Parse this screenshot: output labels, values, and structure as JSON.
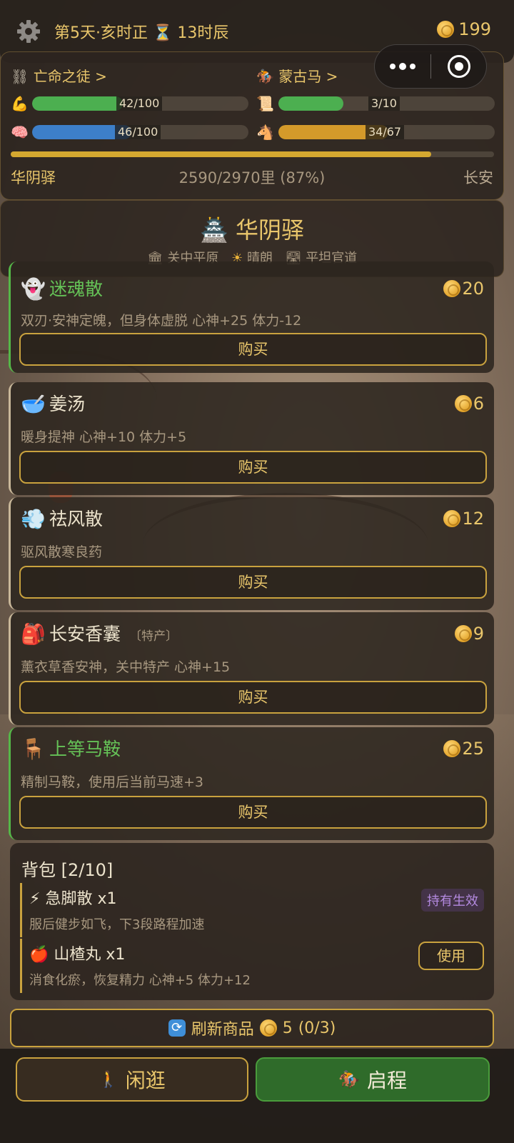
{
  "header": {
    "day_time": "第5天·亥时正",
    "hourglass": "⏳",
    "hours_left": "13时辰",
    "coins": "199"
  },
  "stats": {
    "identity_link": "亡命之徒 >",
    "mount_link": "蒙古马 >",
    "stamina": {
      "text": "42/100",
      "value": 42,
      "max": 100,
      "color": "#4caf50"
    },
    "mind": {
      "text": "46/100",
      "value": 46,
      "max": 100,
      "color": "#3d7fc9"
    },
    "scroll": {
      "text": "3/10",
      "value": 3,
      "max": 10,
      "color": "#4caf50"
    },
    "horse": {
      "text": "34/67",
      "value": 34,
      "max": 67,
      "color": "#d49a2a"
    },
    "route": {
      "from": "华阴驿",
      "progress_text": "2590/2970里 (87%)",
      "to": "长安",
      "fraction": 0.87
    }
  },
  "location": {
    "icon": "🏯",
    "name": "华阴驿",
    "tags": [
      {
        "icon": "🏛",
        "label": "关中平原"
      },
      {
        "icon": "☀",
        "label": "晴朗"
      },
      {
        "icon": "🛣",
        "label": "平坦官道"
      }
    ]
  },
  "shop": {
    "buy_label": "购买",
    "items": [
      {
        "icon": "👻",
        "name": "迷魂散",
        "tag": "",
        "price": "20",
        "desc": "双刃·安神定魄，但身体虚脱  心神+25 体力-12",
        "special": true
      },
      {
        "icon": "🥣",
        "name": "姜汤",
        "tag": "",
        "price": "6",
        "desc": "暖身提神  心神+10 体力+5",
        "special": false
      },
      {
        "icon": "💨",
        "name": "祛风散",
        "tag": "",
        "price": "12",
        "desc": "驱风散寒良药",
        "special": false
      },
      {
        "icon": "🎒",
        "name": "长安香囊",
        "tag": "〔特产〕",
        "price": "9",
        "desc": "薰衣草香安神，关中特产  心神+15",
        "special": false
      },
      {
        "icon": "🪑",
        "name": "上等马鞍",
        "tag": "",
        "price": "25",
        "desc": "精制马鞍，使用后当前马速+3",
        "special": true
      }
    ]
  },
  "bag": {
    "title": "背包 [2/10]",
    "items": [
      {
        "icon": "⚡",
        "name": "急脚散 x1",
        "desc": "服后健步如飞，下3段路程加速",
        "badge": "持有生效"
      },
      {
        "icon": "🍎",
        "name": "山楂丸 x1",
        "desc": "消食化瘀，恢复精力  心神+5 体力+12",
        "action": "使用"
      }
    ]
  },
  "refresh": {
    "label": "刷新商品",
    "cost": "5",
    "count": "(0/3)"
  },
  "footer": {
    "idle_icon": "🚶",
    "idle_label": "闲逛",
    "go_icon": "🏇",
    "go_label": "启程"
  }
}
